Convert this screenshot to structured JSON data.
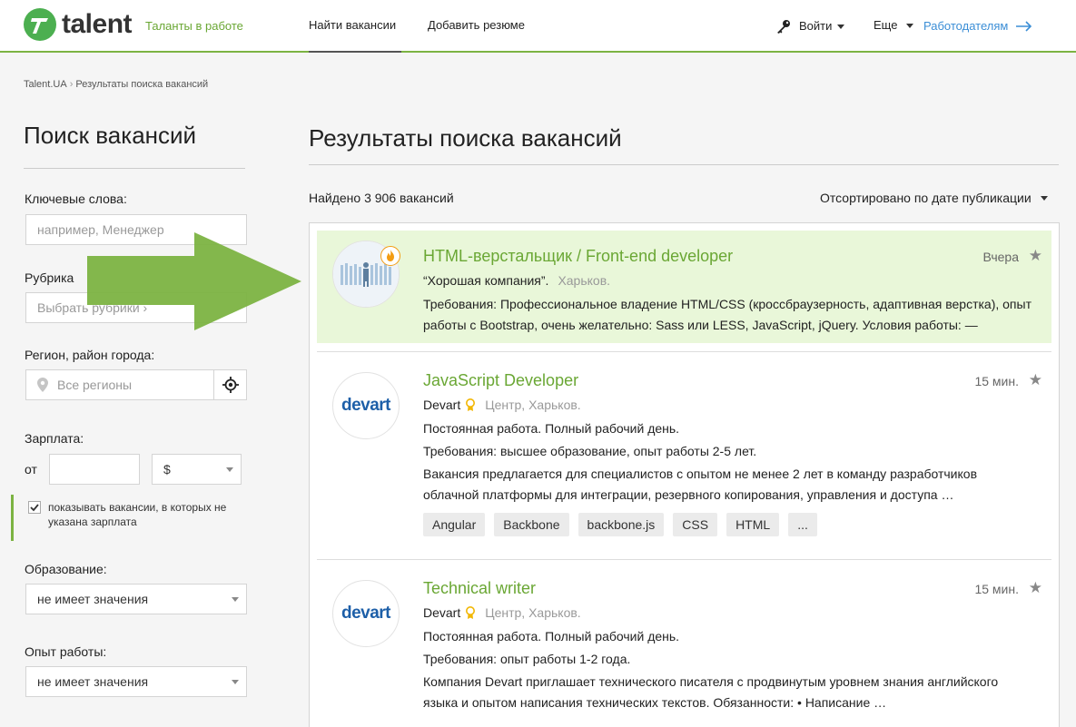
{
  "header": {
    "logo_text": "talent",
    "tagline": "Таланты в работе",
    "nav": [
      "Найти вакансии",
      "Добавить резюме"
    ],
    "login": "Войти",
    "more": "Еще",
    "employers": "Работодателям"
  },
  "breadcrumb": [
    "Talent.UA",
    "Результаты поиска вакансий"
  ],
  "sidebar": {
    "title": "Поиск вакансий",
    "keywords_label": "Ключевые слова:",
    "keywords_placeholder": "например, Менеджер",
    "rubric_label": "Рубрика",
    "rubric_placeholder": "Выбрать рубрики ›",
    "region_label": "Регион, район города:",
    "region_placeholder": "Все регионы",
    "salary_label": "Зарплата:",
    "salary_from": "от",
    "currency": "$",
    "salary_checkbox": "показывать вакансии, в которых не указана зарплата",
    "education_label": "Образование:",
    "education_value": "не имеет значения",
    "experience_label": "Опыт работы:",
    "experience_value": "не имеет значения"
  },
  "main": {
    "title": "Результаты поиска вакансий",
    "found": "Найдено 3 906 вакансий",
    "sort": "Отсортировано по дате публикации"
  },
  "jobs": [
    {
      "title": "HTML-верстальщик / Front-end developer",
      "company": "“Хорошая компания”.",
      "city": "Харьков.",
      "time": "Вчера",
      "desc": "Требования: Профессиональное владение HTML/CSS (кроссбраузерность, адаптивная верстка), опыт работы с Bootstrap, очень желательно: Sass или LESS, JavaScript, jQuery. Условия работы: —"
    },
    {
      "title": "JavaScript Developer",
      "company": "Devart",
      "logo": "devart",
      "city": "Центр, Харьков.",
      "time": "15 мин.",
      "line1": "Постоянная работа. Полный рабочий день.",
      "line2": "Требования: высшее образование, опыт работы 2-5 лет.",
      "desc": "Вакансия предлагается для специалистов с опытом не менее 2 лет в команду разработчиков облачной платформы для интеграции, резервного копирования, управления и доступа …",
      "tags": [
        "Angular",
        "Backbone",
        "backbone.js",
        "CSS",
        "HTML",
        "..."
      ]
    },
    {
      "title": "Technical writer",
      "company": "Devart",
      "logo": "devart",
      "city": "Центр, Харьков.",
      "time": "15 мин.",
      "line1": "Постоянная работа. Полный рабочий день.",
      "line2": "Требования: опыт работы 1-2 года.",
      "desc": "Компания Devart приглашает технического писателя с продвинутым уровнем знания английского языка и опытом написания технических текстов. Обязанности: • Написание …"
    }
  ]
}
